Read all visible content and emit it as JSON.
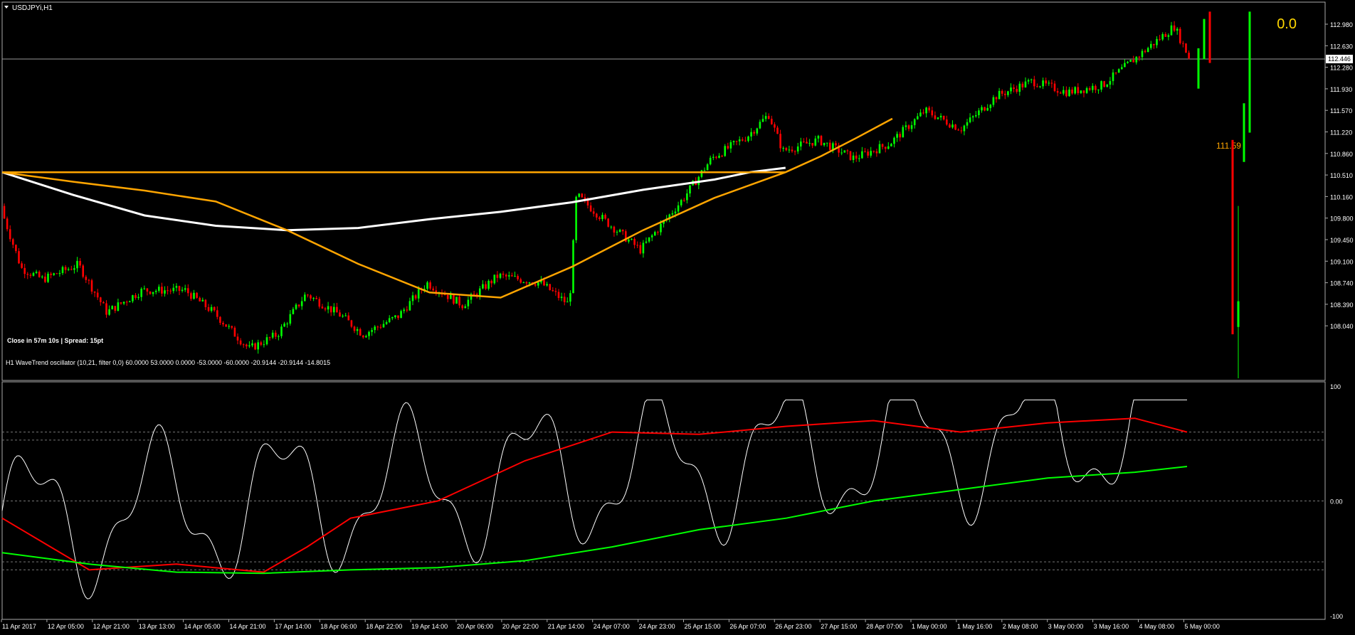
{
  "window": {
    "symbol_title": "USDJPYi,H1",
    "status_text": "Close in 57m 10s | Spread: 15pt",
    "top_right_value": "0.0",
    "ma_level_label": "111.59",
    "current_price_label": "112.446"
  },
  "indicator": {
    "title": "H1 WaveTrend oscillator (10,21, filter 0,0) 60.0000 53.0000 0.0000 -53.0000 -60.0000 -20.9144 -20.9144 -14.8015",
    "axis_labels": [
      "100",
      "0.00",
      "-100"
    ]
  },
  "price_axis": {
    "labels": [
      "112.980",
      "112.630",
      "112.280",
      "111.930",
      "111.570",
      "111.220",
      "110.860",
      "110.510",
      "110.160",
      "109.800",
      "109.450",
      "109.100",
      "108.740",
      "108.390",
      "108.040"
    ]
  },
  "time_axis": {
    "labels": [
      "11 Apr 2017",
      "12 Apr 05:00",
      "12 Apr 21:00",
      "13 Apr 13:00",
      "14 Apr 05:00",
      "14 Apr 21:00",
      "17 Apr 14:00",
      "18 Apr 06:00",
      "18 Apr 22:00",
      "19 Apr 14:00",
      "20 Apr 06:00",
      "20 Apr 22:00",
      "21 Apr 14:00",
      "24 Apr 07:00",
      "24 Apr 23:00",
      "25 Apr 15:00",
      "26 Apr 07:00",
      "26 Apr 23:00",
      "27 Apr 15:00",
      "28 Apr 07:00",
      "1 May 00:00",
      "1 May 16:00",
      "2 May 08:00",
      "3 May 00:00",
      "3 May 16:00",
      "4 May 08:00",
      "5 May 00:00"
    ]
  },
  "chart_data": {
    "type": "line",
    "title": "USDJPYi,H1",
    "ylim": [
      108.04,
      113.16
    ],
    "series": [
      {
        "name": "",
        "color": "#FFFFFF",
        "points": [
          [
            0,
            110.86
          ],
          [
            100,
            110.55
          ],
          [
            200,
            110.27
          ],
          [
            300,
            110.13
          ],
          [
            400,
            110.07
          ],
          [
            500,
            110.1
          ],
          [
            600,
            110.22
          ],
          [
            700,
            110.32
          ],
          [
            800,
            110.45
          ],
          [
            900,
            110.62
          ],
          [
            1000,
            110.76
          ],
          [
            1050,
            110.86
          ],
          [
            1100,
            110.92
          ]
        ]
      },
      {
        "name": "",
        "color": "#FFA500",
        "points": [
          [
            0,
            110.86
          ],
          [
            100,
            110.73
          ],
          [
            200,
            110.61
          ],
          [
            300,
            110.46
          ],
          [
            400,
            110.07
          ],
          [
            500,
            109.61
          ],
          [
            600,
            109.22
          ],
          [
            700,
            109.15
          ],
          [
            800,
            109.57
          ],
          [
            900,
            110.07
          ],
          [
            1000,
            110.51
          ],
          [
            1100,
            110.86
          ],
          [
            1150,
            111.08
          ],
          [
            1200,
            111.33
          ],
          [
            1250,
            111.59
          ]
        ]
      },
      {
        "name": "",
        "color": "#FFA500",
        "points": [
          [
            0,
            110.86
          ],
          [
            200,
            110.86
          ],
          [
            400,
            110.86
          ],
          [
            600,
            110.86
          ],
          [
            800,
            110.86
          ],
          [
            1000,
            110.86
          ],
          [
            1100,
            110.86
          ]
        ]
      }
    ],
    "oscillator": {
      "ylim": [
        -100,
        100
      ],
      "levels": [
        60,
        53,
        0,
        -53,
        -60
      ],
      "series": [
        {
          "name": "",
          "color": "#FF0000",
          "points": [
            [
              0,
              -15
            ],
            [
              100,
              -60
            ],
            [
              200,
              -55
            ],
            [
              300,
              -62
            ],
            [
              350,
              -40
            ],
            [
              400,
              -15
            ],
            [
              500,
              0
            ],
            [
              600,
              35
            ],
            [
              700,
              60
            ],
            [
              800,
              58
            ],
            [
              900,
              65
            ],
            [
              1000,
              70
            ],
            [
              1100,
              60
            ],
            [
              1200,
              68
            ],
            [
              1300,
              72
            ],
            [
              1360,
              60
            ]
          ]
        },
        {
          "name": "",
          "color": "#00FF00",
          "points": [
            [
              0,
              -45
            ],
            [
              100,
              -55
            ],
            [
              200,
              -62
            ],
            [
              300,
              -63
            ],
            [
              400,
              -60
            ],
            [
              500,
              -58
            ],
            [
              600,
              -52
            ],
            [
              700,
              -40
            ],
            [
              800,
              -25
            ],
            [
              900,
              -15
            ],
            [
              1000,
              0
            ],
            [
              1100,
              10
            ],
            [
              1200,
              20
            ],
            [
              1300,
              25
            ],
            [
              1360,
              30
            ]
          ]
        }
      ]
    }
  }
}
